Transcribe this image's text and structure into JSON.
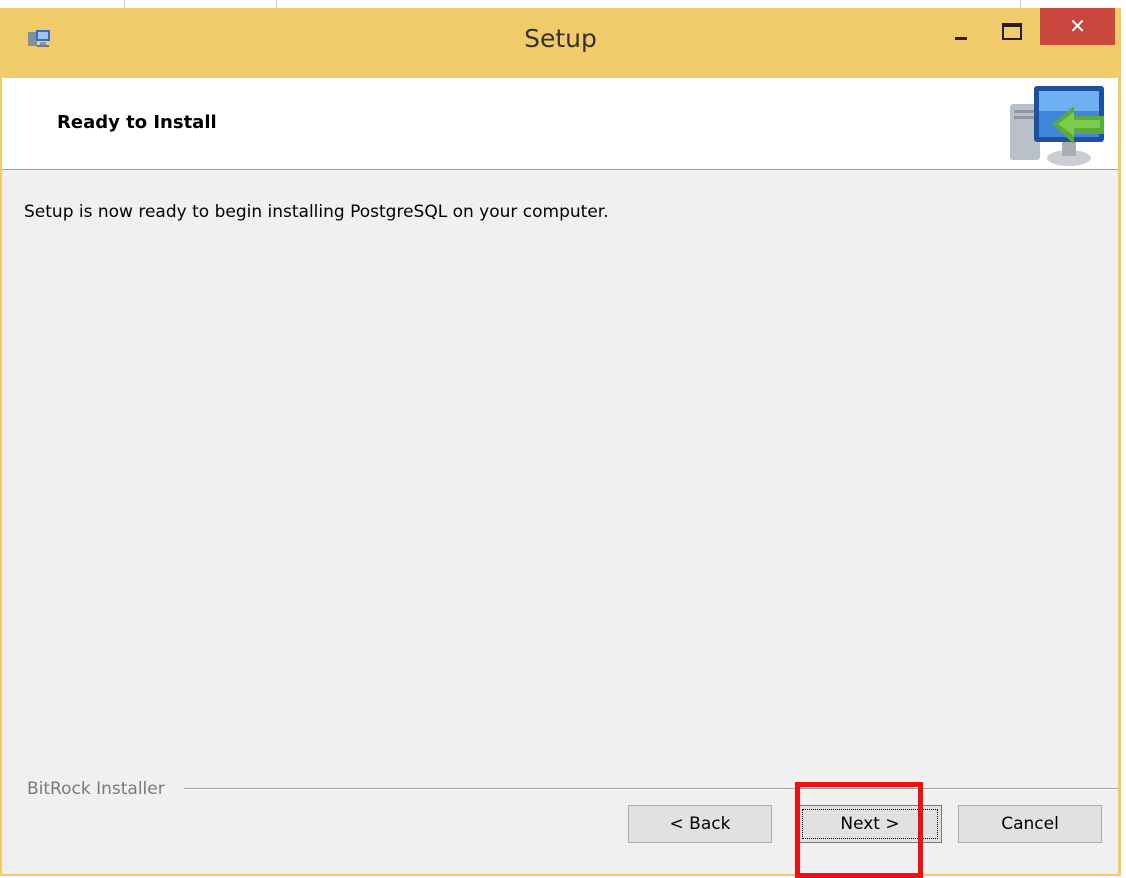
{
  "window": {
    "title": "Setup",
    "app_icon": "installer-icon",
    "controls": {
      "minimize_icon": "minimize-icon",
      "maximize_icon": "maximize-icon",
      "close_glyph": "✕"
    }
  },
  "header": {
    "title": "Ready to Install",
    "icon": "computer-install-arrow-icon"
  },
  "body": {
    "message": "Setup is now ready to begin installing PostgreSQL on your computer."
  },
  "footer": {
    "brand": "BitRock Installer"
  },
  "buttons": {
    "back": "< Back",
    "next": "Next >",
    "cancel": "Cancel"
  },
  "annotation": {
    "highlight_color": "#ee1111",
    "target": "next-button"
  },
  "colors": {
    "titlebar": "#f1cb6a",
    "close": "#c9463d",
    "dialog_bg": "#f0f0f0"
  }
}
